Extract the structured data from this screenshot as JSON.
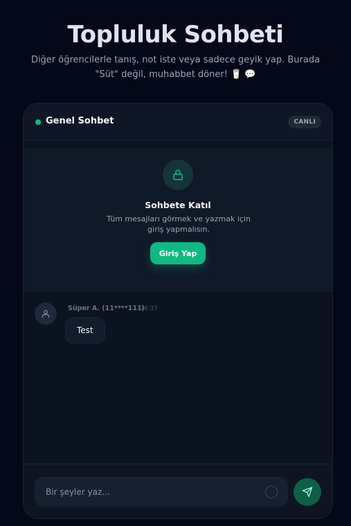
{
  "hero": {
    "title": "Topluluk Sohbeti",
    "subtitle": "Diğer öğrencilerle tanış, not iste veya sadece geyik yap. Burada \"Süt\" değil, muhabbet döner! 🥛 💬"
  },
  "chat": {
    "room_title": "Genel Sohbet",
    "live_badge": "CANLI",
    "join": {
      "title": "Sohbete Katıl",
      "description": "Tüm mesajları görmek ve yazmak için giriş yapmalısın.",
      "button_label": "Giriş Yap"
    },
    "messages": [
      {
        "author": "Süper A. (11****111)",
        "time": "16:37",
        "text": "Test"
      }
    ],
    "composer": {
      "placeholder": "Bir şeyler yaz..."
    }
  },
  "icons": {
    "lock": "lock-icon",
    "user": "user-icon",
    "emoji": "emoji-icon",
    "send": "send-icon"
  },
  "colors": {
    "accent": "#10b981",
    "background": "#040818",
    "card": "#0b1220"
  }
}
